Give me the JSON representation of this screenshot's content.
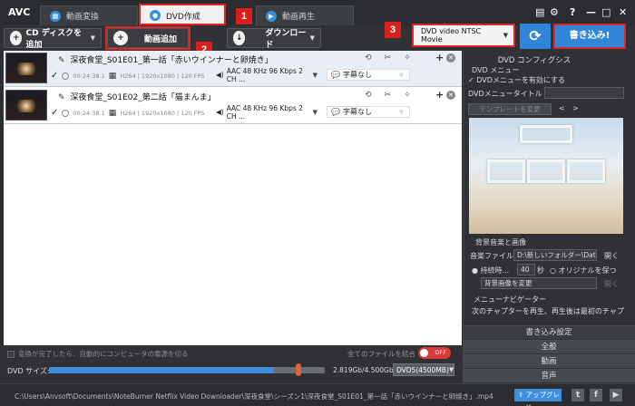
{
  "app": {
    "logo": "AVC"
  },
  "tabs": [
    {
      "label": "動画変換",
      "icon": "film-icon"
    },
    {
      "label": "DVD作成",
      "icon": "disc-icon"
    },
    {
      "label": "動画再生",
      "icon": "play-icon"
    }
  ],
  "badges": [
    "1",
    "2",
    "3",
    "4"
  ],
  "toolbar": {
    "cd_label": "CD ディスクを追加",
    "add_video_label": "動画追加",
    "download_label": "ダウンロード",
    "profile": "DVD video NTSC Movie",
    "burn_label": "書き込み!"
  },
  "files": [
    {
      "title": "深夜食堂_S01E01_第一話「赤いウインナーと卵焼き」",
      "duration": "00:24:38.1",
      "video": "H264 | 1920x1080 | 120 FPS",
      "audio": "AAC 48 KHz 96 Kbps 2 CH ...",
      "subtitle": "字幕なし"
    },
    {
      "title": "深夜食堂_S01E02_第二話「猫まんま」",
      "duration": "00:24:38.1",
      "video": "H264 | 1920x1080 | 120 FPS",
      "audio": "AAC 48 KHz 96 Kbps 2 CH ...",
      "subtitle": "字幕なし"
    }
  ],
  "bottom": {
    "shutdown_label": "変換が完了したら、自動的にコンピュータの電源を切る",
    "merge_label": "全てのファイルを結合",
    "merge_state": "OFF",
    "size_label": "DVD サイズ:",
    "size_used_fraction": 0.905,
    "size_text": "2.819Gb/4.500Gb",
    "dvd_type": "DVD5(4500MB)"
  },
  "panel": {
    "title": "DVD コンフィグシス",
    "menu_section": "DVD メニュー",
    "enable_menu": "DVDメニューを有効にする",
    "menu_title_label": "DVDメニュータイトル",
    "template_btn": "テンプレートを変更",
    "nav_prev": "<",
    "nav_next": ">",
    "bg_section": "背景音楽と画像",
    "music_label": "音楽ファイル",
    "music_path": "D:\\新しいフォルダー\\Datz",
    "open_label": "開く",
    "duration_label": "持続時...",
    "duration_value": "40",
    "seconds_label": "秒",
    "keep_original": "オリジナルを保つ",
    "bg_image_btn": "背景画像を変更",
    "open_label2": "開く",
    "navigator_label": "メニューナビゲーター",
    "navigator_text": "次のチャプターを再生、再生後は最初のチャプ",
    "burn_settings": "書き込み設定",
    "general": "全般",
    "video": "動画",
    "audio": "音声"
  },
  "status": {
    "path": "C:\\Users\\Anvsoft\\Documents\\NoteBurner Netflix Video Downloader\\深夜食堂\\シーズン1\\深夜食堂_S01E01_第一話「赤いウインナーと卵焼き」.mp4",
    "upgrade_label": "アップグレード"
  }
}
